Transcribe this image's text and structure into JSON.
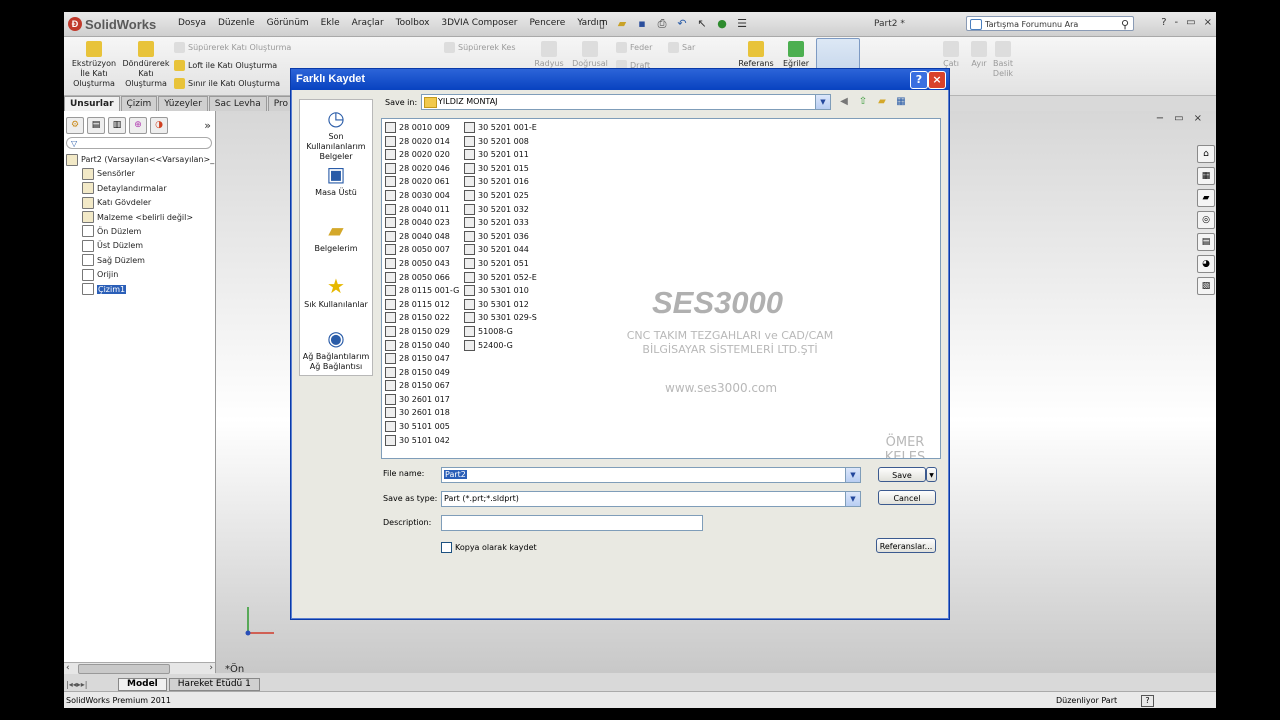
{
  "app": {
    "logo": "SolidWorks",
    "menus": [
      "Dosya",
      "Düzenle",
      "Görünüm",
      "Ekle",
      "Araçlar",
      "Toolbox",
      "3DVIA Composer",
      "Pencere",
      "Yardım"
    ],
    "doc_title": "Part2 *",
    "search_placeholder": "Tartışma Forumunu Ara",
    "win_controls": [
      "?",
      "-",
      "▭",
      "×"
    ]
  },
  "ribbon": {
    "extrude": "Ekstrüzyon İle Katı Oluşturma",
    "revolve": "Döndürerek Katı Oluşturma",
    "sweep": "Süpürerek Katı Oluşturma",
    "loft": "Loft ile Katı Oluşturma",
    "boundary": "Sınır ile Katı Oluşturma",
    "swept_cut": "Süpürerek Kes",
    "fillet": "Radyus",
    "linear_pattern": "Doğrusal",
    "rib": "Feder",
    "wrap": "Sar",
    "reference": "Referans",
    "curves": "Eğriler",
    "dome": "Çatı",
    "split": "Ayır",
    "simplify": "Basit Delik",
    "draft": "Draft"
  },
  "tabs": [
    "Unsurlar",
    "Çizim",
    "Yüzeyler",
    "Sac Levha",
    "Pro"
  ],
  "tree": [
    {
      "label": "Part2  (Varsayılan<<Varsayılan>_"
    },
    {
      "label": "Sensörler"
    },
    {
      "label": "Detaylandırmalar"
    },
    {
      "label": "Katı Gövdeler"
    },
    {
      "label": "Malzeme <belirli değil>"
    },
    {
      "label": "Ön Düzlem"
    },
    {
      "label": "Üst Düzlem"
    },
    {
      "label": "Sağ Düzlem"
    },
    {
      "label": "Orijin"
    },
    {
      "label": "Çizim1"
    }
  ],
  "viewport": {
    "view_label": "*Ön"
  },
  "bottom_tabs": [
    "Model",
    "Hareket Etüdü 1"
  ],
  "status": {
    "left": "SolidWorks Premium 2011",
    "right": "Düzenliyor Part",
    "help": "?"
  },
  "dialog": {
    "title": "Farklı Kaydet",
    "places": [
      "Son Kullanılanlarım Belgeler",
      "Masa Üstü",
      "Belgelerim",
      "Sık Kullanılanlar",
      "Ağ Bağlantılarım Ağ Bağlantısı"
    ],
    "save_in_label": "Save in:",
    "save_in_value": "YILDIZ MONTAJ",
    "files_col1": [
      "28 0010 009",
      "28 0020 014",
      "28 0020 020",
      "28 0020 046",
      "28 0020 061",
      "28 0030 004",
      "28 0040 011",
      "28 0040 023",
      "28 0040 048",
      "28 0050 007",
      "28 0050 043",
      "28 0050 066",
      "28 0115 001-G",
      "28 0115 012",
      "28 0150 022",
      "28 0150 029",
      "28 0150 040",
      "28 0150 047",
      "28 0150 049",
      "28 0150 067",
      "30 2601 017",
      "30 2601 018",
      "30 5101 005",
      "30 5101 042"
    ],
    "files_col2": [
      "30 5201 001-E",
      "30 5201 008",
      "30 5201 011",
      "30 5201 015",
      "30 5201 016",
      "30 5201 025",
      "30 5201 032",
      "30 5201 033",
      "30 5201 036",
      "30 5201 044",
      "30 5201 051",
      "30 5201 052-E",
      "30 5301 010",
      "30 5301 012",
      "30 5301 029-S",
      "51008-G",
      "52400-G"
    ],
    "watermark": {
      "brand": "SES3000",
      "line1": "CNC TAKIM TEZGAHLARI ve CAD/CAM",
      "line2": "BİLGİSAYAR SİSTEMLERİ LTD.ŞTİ",
      "url": "www.ses3000.com",
      "name": "ÖMER KELEŞ"
    },
    "file_name_label": "File name:",
    "file_name_value": "Part2",
    "save_type_label": "Save as type:",
    "save_type_value": "Part (*.prt;*.sldprt)",
    "description_label": "Description:",
    "description_value": "",
    "copy_label": "Kopya olarak kaydet",
    "save_button": "Save",
    "cancel_button": "Cancel",
    "references_button": "Referanslar..."
  },
  "colors": {
    "title_bar": "#0842c0",
    "selection": "#2b5fb8",
    "close": "#d9422b"
  }
}
